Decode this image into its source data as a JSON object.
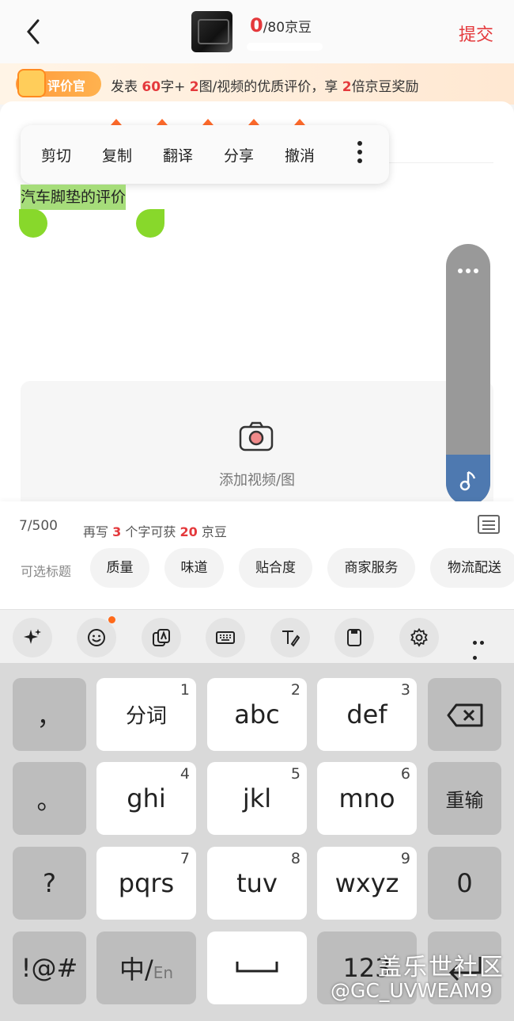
{
  "header": {
    "count_current": "0",
    "count_rest": "/80京豆",
    "submit_label": "提交"
  },
  "banner": {
    "badge_label": "评价官",
    "text_prefix": "发表",
    "chars": "60",
    "text_mid1": "字+",
    "images": "2",
    "text_mid2": "图/视频的优质评价，享",
    "multiplier": "2",
    "text_suffix": "倍京豆奖励"
  },
  "context_menu": {
    "items": [
      "剪切",
      "复制",
      "翻译",
      "分享",
      "撤消"
    ]
  },
  "editor": {
    "selected_text": "汽车脚垫的评价"
  },
  "media": {
    "add_label": "添加视频/图"
  },
  "stats": {
    "char_count": "7/500",
    "hint_prefix": "再写",
    "hint_chars": "3",
    "hint_mid": "个字可获",
    "hint_beans": "20",
    "hint_suffix": "京豆"
  },
  "tags": {
    "label": "可选标题",
    "items": [
      "质量",
      "味道",
      "贴合度",
      "商家服务",
      "物流配送"
    ]
  },
  "keyboard": {
    "toolbar_icons": [
      "sparkle-icon",
      "emoji-icon",
      "image-text-icon",
      "keyboard-icon",
      "handwriting-icon",
      "clipboard-icon",
      "settings-icon",
      "more-icon"
    ],
    "keys": {
      "comma": "，",
      "fenci": "分词",
      "fenci_num": "1",
      "abc": "abc",
      "abc_num": "2",
      "def": "def",
      "def_num": "3",
      "period": "。",
      "ghi": "ghi",
      "ghi_num": "4",
      "jkl": "jkl",
      "jkl_num": "5",
      "mno": "mno",
      "mno_num": "6",
      "reinput": "重输",
      "question": "?",
      "pqrs": "pqrs",
      "pqrs_num": "7",
      "tuv": "tuv",
      "tuv_num": "8",
      "wxyz": "wxyz",
      "wxyz_num": "9",
      "zero": "0",
      "symbols": "!@#",
      "lang_main": "中/",
      "lang_alt": "En",
      "num": "123"
    }
  },
  "watermark": {
    "line1": "盖乐世社区",
    "line2": "@GC_UVWEAM9"
  }
}
